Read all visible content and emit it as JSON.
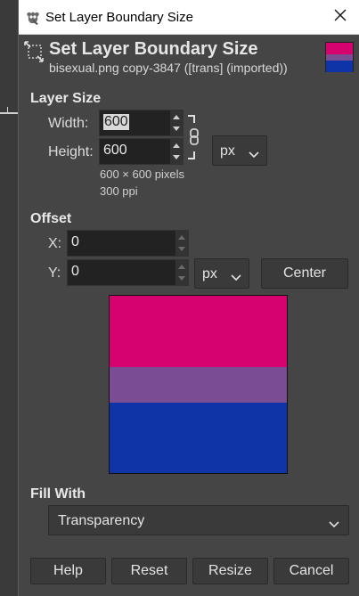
{
  "window": {
    "title": "Set Layer Boundary Size",
    "icons": {
      "app": "gimp-icon",
      "close": "close-icon"
    }
  },
  "header": {
    "title": "Set Layer Boundary Size",
    "subtitle": "bisexual.png copy-3847 ([trans] (imported))",
    "icon": "layer-boundary-icon"
  },
  "layer_size": {
    "section_label": "Layer Size",
    "width_label": "Width:",
    "width_value": "600",
    "height_label": "Height:",
    "height_value": "600",
    "unit": "px",
    "info_pixels": "600 × 600 pixels",
    "info_ppi": "300 ppi",
    "chain_icon": "chain-link-icon"
  },
  "offset": {
    "section_label": "Offset",
    "x_label": "X:",
    "x_value": "0",
    "y_label": "Y:",
    "y_value": "0",
    "unit": "px",
    "center_label": "Center"
  },
  "preview": {
    "colors": [
      "#d60270",
      "#7a4c94",
      "#0e34a8"
    ]
  },
  "fill": {
    "section_label": "Fill With",
    "value": "Transparency"
  },
  "buttons": {
    "help": "Help",
    "reset": "Reset",
    "resize": "Resize",
    "cancel": "Cancel"
  }
}
